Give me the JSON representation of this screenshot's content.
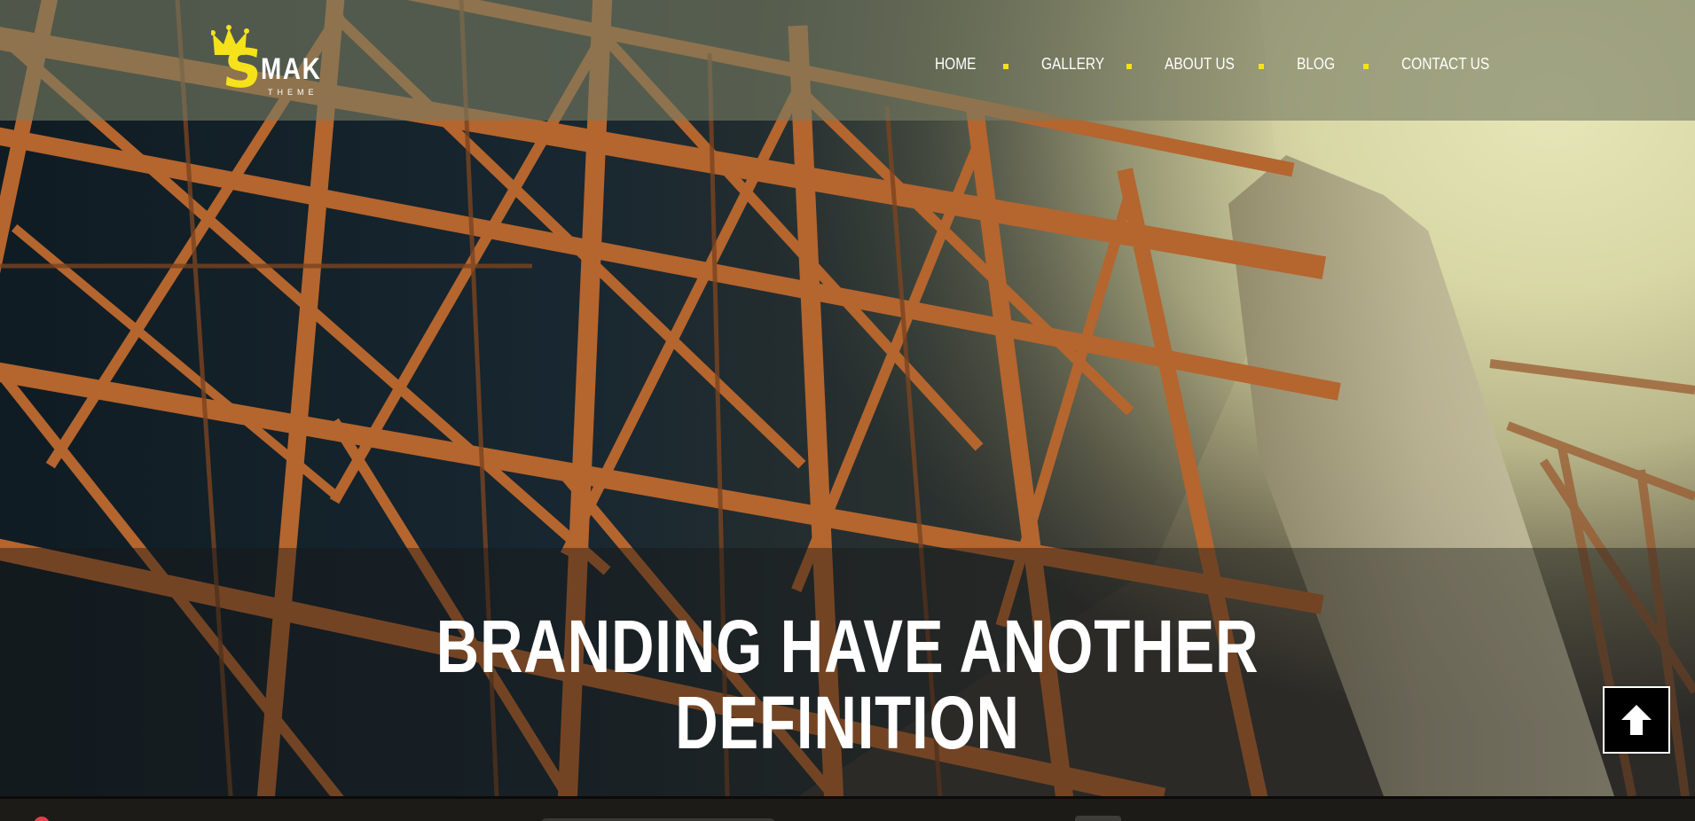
{
  "site": {
    "logo": {
      "letter": "S",
      "word": "MAK",
      "tagline": "THEME"
    },
    "nav": {
      "items": [
        {
          "label": "HOME"
        },
        {
          "label": "GALLERY"
        },
        {
          "label": "ABOUT US"
        },
        {
          "label": "BLOG"
        },
        {
          "label": "CONTACT US"
        }
      ]
    }
  },
  "hero": {
    "headline_line1": "BRANDING HAVE ANOTHER",
    "headline_line2": "DEFINITION",
    "back_to_top_icon": "arrow-up-icon"
  },
  "colors": {
    "accent": "#f5e21a",
    "header_overlay": "#787c62",
    "steel": "#b86a34",
    "sky": "#e6e6b8"
  }
}
